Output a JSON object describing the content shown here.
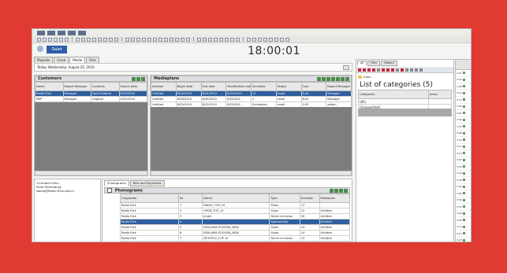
{
  "clock": "18:00:01",
  "brand_label": "Dalet",
  "main_tabs": [
    "Playlists",
    "Clock",
    "Media",
    "Files"
  ],
  "date_label": "Today: Wednesday, August 25, 2010",
  "customers": {
    "title": "Customers",
    "columns": [
      "Name",
      "Report Manager",
      "Contacts",
      "Search date"
    ],
    "rows": [
      [
        "Radio Rick",
        "Manager",
        "Saint Roberts",
        "8/25/2010"
      ],
      [
        "PMP",
        "Manager",
        "Ungerer",
        "4/25/2010"
      ]
    ]
  },
  "mediaplans": {
    "title": "Mediaplans",
    "columns": [
      "Number",
      "Begin date",
      "End date",
      "Modification date",
      "Schedule",
      "Status",
      "Cost",
      "Report Manager"
    ],
    "rows": [
      [
        "Untitled",
        "8/24/2010",
        "8/24/2010",
        "8/24/2010",
        "12",
        "small",
        "8.00",
        "Manager"
      ],
      [
        "Untitled",
        "8/26/2010",
        "8/26/2010",
        "8/25/201...",
        "2",
        "small",
        "8.00",
        "Manager"
      ],
      [
        "Untitled",
        "8/25/2010",
        "8/22/2010",
        "8/25/201...",
        "Scheduled",
        "small",
        "0.00",
        "admin"
      ]
    ]
  },
  "contact_info": [
    "<Contact Info>",
    "Saint Petersburg",
    "Name@Radio Rick.spb.ru"
  ],
  "sub_tabs": [
    "Phonograms",
    "Bills and Payments"
  ],
  "phonograms": {
    "title": "Phonograms",
    "columns": [
      "Copywriter",
      "Nr",
      "Name",
      "Type",
      "Duration",
      "Mediaplan"
    ],
    "rows": [
      [
        "Radio Rick",
        "1",
        "RADIO_TOP_10",
        "Show",
        "12",
        ""
      ],
      [
        "Radio Rick",
        "2",
        "OPEN_TOP_10",
        "Show",
        "12",
        "Untitled"
      ],
      [
        "Radio Rick",
        "3",
        "Jingle",
        "Direct inclusion",
        "30",
        "Untitled"
      ],
      [
        "Radio Rick",
        "4",
        "",
        "Sponsorship",
        "",
        "Untitled"
      ],
      [
        "Radio Rick",
        "5",
        "REKLAMA-POGODA_NEW",
        "Show",
        "14",
        "Untitled"
      ],
      [
        "Radio Rick",
        "6",
        "REKLAMA-POGODA_NEW",
        "Show",
        "14",
        "Untitled"
      ],
      [
        "Radio Rick",
        "7",
        "RETOP10_TOP 10",
        "Direct inclusion",
        "12",
        "Untitled"
      ],
      [
        "Radio Rick",
        "8",
        "LUCHIKI_HT_TOP 10",
        "Direct inclusion",
        "12",
        "Untitled"
      ]
    ],
    "selected_index": 3
  },
  "right_tabs": [
    "All",
    "Files",
    "Folders"
  ],
  "categories": {
    "folder_label": "main",
    "title": "List of categories (5)",
    "columns": [
      "Categories",
      "Items"
    ],
    "rows": [
      [
        "(All)",
        ""
      ],
      [
        "(Unspecified)",
        ""
      ],
      [
        "Jingl",
        "48"
      ]
    ]
  },
  "list_times": [
    "2:01",
    "2:07",
    "2:09",
    "2:10",
    "2:12",
    "3:00",
    "3:01",
    "3:02",
    "3:05",
    "3:08",
    "3:10",
    "3:12",
    "3:15",
    "3:20",
    "3:25",
    "3:30",
    "3:35",
    "3:40",
    "3:45",
    "3:50",
    "3:55",
    "4:00",
    "4:05",
    "4:10",
    "4:15",
    "4:20",
    "4:25",
    "4:30",
    "4:35",
    "4:40"
  ]
}
